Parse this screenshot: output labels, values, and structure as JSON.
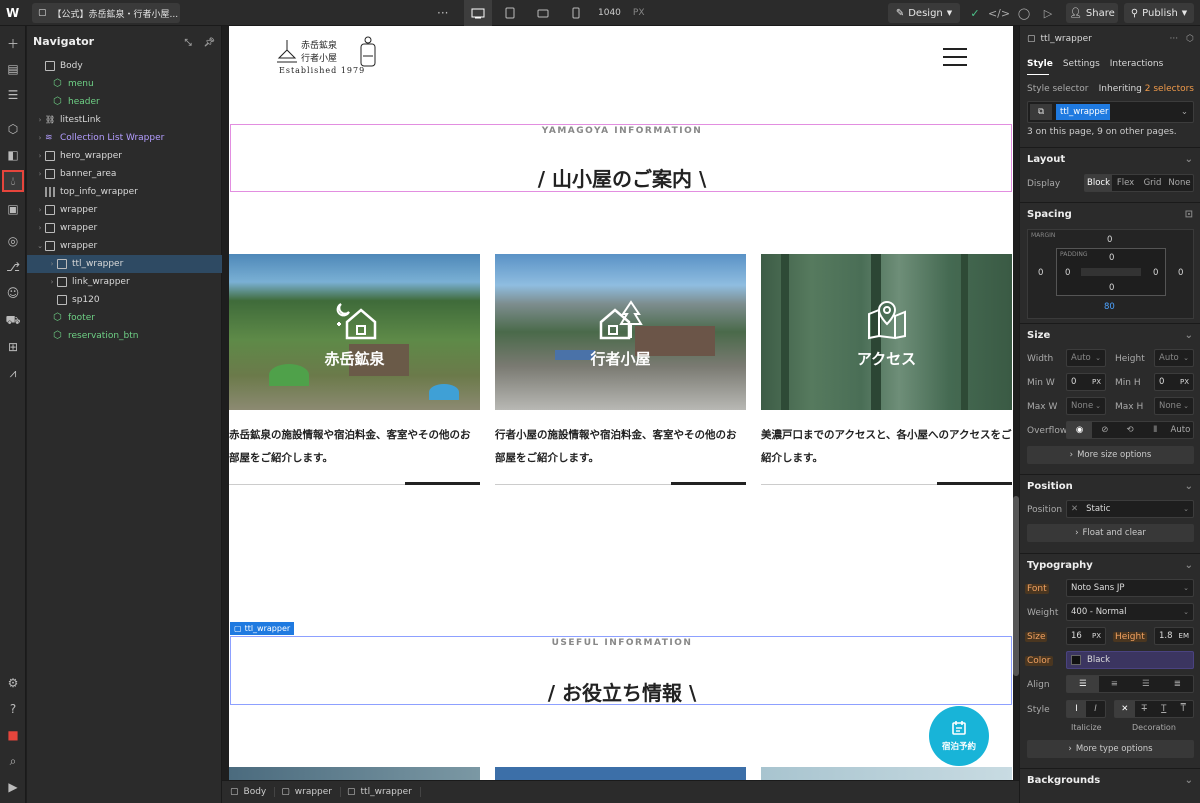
{
  "topbar": {
    "logo": "W",
    "page_name": "【公式】赤岳鉱泉・行者小屋...",
    "more": "···",
    "width_value": "1040",
    "width_unit": "PX",
    "design_label": "Design",
    "share_label": "Share",
    "publish_label": "Publish"
  },
  "navigator": {
    "title": "Navigator",
    "items": [
      {
        "label": "Body",
        "type": "box"
      },
      {
        "label": "menu",
        "type": "component"
      },
      {
        "label": "header",
        "type": "component"
      },
      {
        "label": "litestLink",
        "type": "link"
      },
      {
        "label": "Collection List Wrapper",
        "type": "collection"
      },
      {
        "label": "hero_wrapper",
        "type": "box"
      },
      {
        "label": "banner_area",
        "type": "box"
      },
      {
        "label": "top_info_wrapper",
        "type": "grid"
      },
      {
        "label": "wrapper",
        "type": "box"
      },
      {
        "label": "wrapper",
        "type": "box"
      },
      {
        "label": "wrapper",
        "type": "box"
      },
      {
        "label": "ttl_wrapper",
        "type": "box",
        "selected": true
      },
      {
        "label": "link_wrapper",
        "type": "box"
      },
      {
        "label": "sp120",
        "type": "box"
      },
      {
        "label": "footer",
        "type": "component"
      },
      {
        "label": "reservation_btn",
        "type": "component"
      }
    ]
  },
  "site": {
    "logo_line1": "赤岳鉱泉",
    "logo_line2": "行者小屋",
    "logo_line3": "Established 1979",
    "section1_en": "YAMAGOYA INFORMATION",
    "section1_jp": "/ 山小屋のご案内 \\",
    "section2_en": "USEFUL INFORMATION",
    "section2_jp": "/ お役立ち情報 \\",
    "selected_tag": "ttl_wrapper",
    "cards": [
      {
        "title": "赤岳鉱泉",
        "icon": "moon-house-icon",
        "text": "赤岳鉱泉の施設情報や宿泊料金、客室やその他のお部屋をご紹介します。"
      },
      {
        "title": "行者小屋",
        "icon": "tree-house-icon",
        "text": "行者小屋の施設情報や宿泊料金、客室やその他のお部屋をご紹介します。"
      },
      {
        "title": "アクセス",
        "icon": "map-pin-icon",
        "text": "美濃戸口までのアクセスと、各小屋へのアクセスをご紹介します。"
      }
    ],
    "reservation_label": "宿泊予約"
  },
  "breadcrumbs": [
    "Body",
    "wrapper",
    "ttl_wrapper"
  ],
  "right_panel": {
    "element_name": "ttl_wrapper",
    "tabs": [
      "Style",
      "Settings",
      "Interactions"
    ],
    "style_selector_label": "Style selector",
    "inheriting_label": "Inheriting",
    "inheriting_count": "2 selectors",
    "selector_chip": "ttl_wrapper",
    "usage_text": "3 on this page, 9 on other pages.",
    "layout": {
      "title": "Layout",
      "display_label": "Display",
      "options": [
        "Block",
        "Flex",
        "Grid",
        "None"
      ],
      "active": "Block"
    },
    "spacing": {
      "title": "Spacing",
      "margin_label": "MARGIN",
      "padding_label": "PADDING",
      "margin_top": "0",
      "margin_left": "0",
      "margin_right": "0",
      "margin_bottom": "80",
      "padding_top": "0",
      "padding_left": "0",
      "padding_right": "0",
      "padding_bottom": "0"
    },
    "size": {
      "title": "Size",
      "width_label": "Width",
      "width_value": "Auto",
      "height_label": "Height",
      "height_value": "Auto",
      "minw_label": "Min W",
      "minw_value": "0",
      "minw_unit": "PX",
      "minh_label": "Min H",
      "minh_value": "0",
      "minh_unit": "PX",
      "maxw_label": "Max W",
      "maxw_value": "None",
      "maxh_label": "Max H",
      "maxh_value": "None",
      "overflow_label": "Overflow",
      "overflow_auto": "Auto",
      "more_label": "More size options"
    },
    "position": {
      "title": "Position",
      "label": "Position",
      "value": "Static",
      "float_label": "Float and clear"
    },
    "typography": {
      "title": "Typography",
      "font_label": "Font",
      "font_value": "Noto Sans JP",
      "weight_label": "Weight",
      "weight_value": "400 - Normal",
      "size_label": "Size",
      "size_value": "16",
      "size_unit": "PX",
      "height_label": "Height",
      "height_value": "1.8",
      "height_unit": "EM",
      "color_label": "Color",
      "color_value": "Black",
      "align_label": "Align",
      "style_label": "Style",
      "italicize_label": "Italicize",
      "decoration_label": "Decoration",
      "more_label": "More type options"
    },
    "backgrounds": {
      "title": "Backgrounds"
    }
  },
  "colors": {
    "accent": "#1f7ae0",
    "outline": "#e28ee0",
    "reservation": "#18b4d8"
  }
}
